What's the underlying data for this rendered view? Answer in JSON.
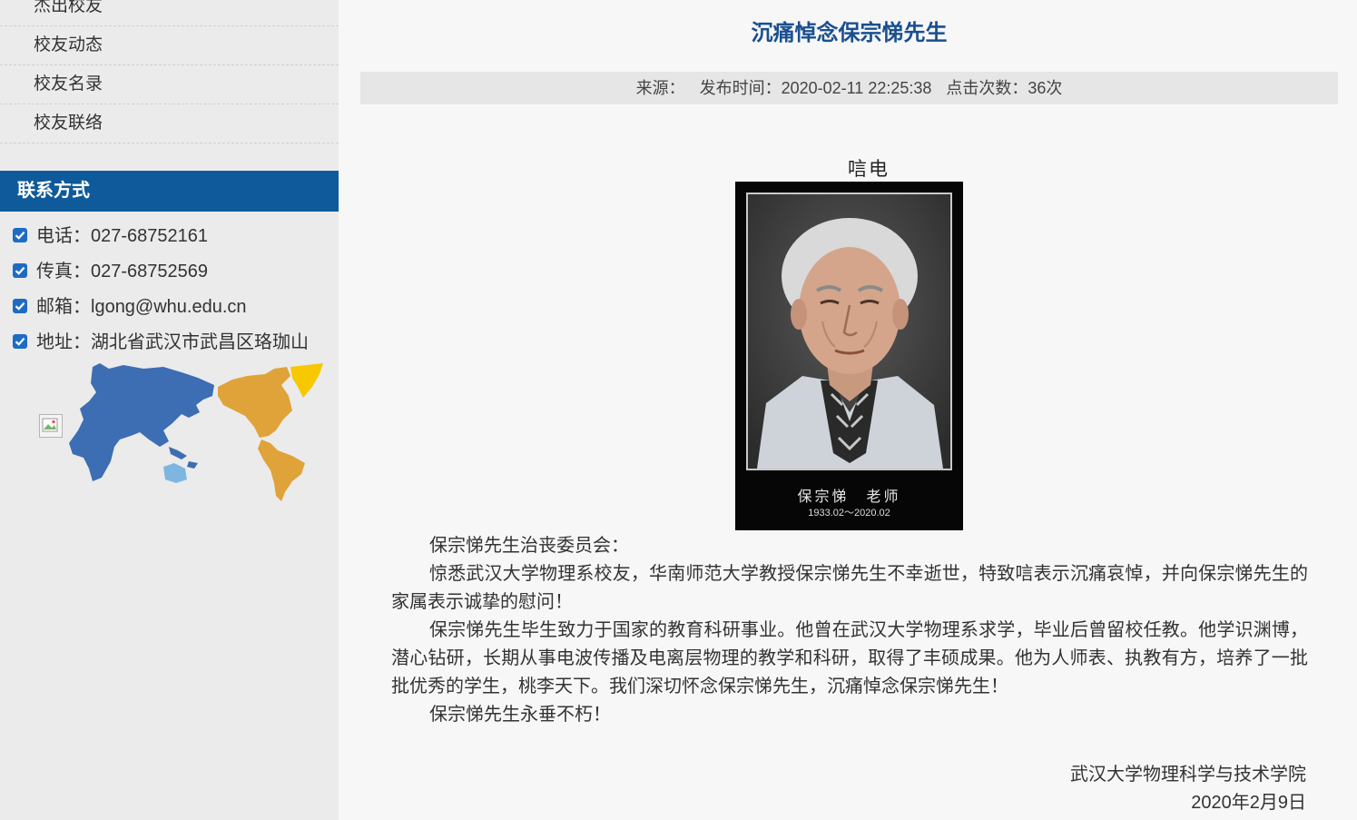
{
  "sidebar": {
    "nav": [
      "杰出校友",
      "校友动态",
      "校友名录",
      "校友联络"
    ],
    "contact_title": "联系方式",
    "contacts": [
      "电话：027-68752161",
      "传真：027-68752569",
      "邮箱：lgong@whu.edu.cn",
      "地址：湖北省武汉市武昌区珞珈山"
    ]
  },
  "article": {
    "title": "沉痛悼念保宗悌先生",
    "source": "来源：",
    "publish_time": "发布时间：2020-02-11 22:25:38",
    "views": "点击次数：36次",
    "caption": "唁电",
    "photo_name": "保宗悌　老师",
    "photo_dates": "1933.02～2020.02",
    "paragraphs": [
      "保宗悌先生治丧委员会：",
      "惊悉武汉大学物理系校友，华南师范大学教授保宗悌先生不幸逝世，特致唁表示沉痛哀悼，并向保宗悌先生的家属表示诚挚的慰问！",
      "保宗悌先生毕生致力于国家的教育科研事业。他曾在武汉大学物理系求学，毕业后曾留校任教。他学识渊博，潜心钻研，长期从事电波传播及电离层物理的教学和科研，取得了丰硕成果。他为人师表、执教有方，培养了一批批优秀的学生，桃李天下。我们深切怀念保宗悌先生，沉痛悼念保宗悌先生！",
      "保宗悌先生永垂不朽！"
    ],
    "signature_org": "武汉大学物理科学与技术学院",
    "signature_date": "2020年2月9日"
  },
  "colors": {
    "accent": "#0e5a9a",
    "title": "#1a4f8f",
    "checkbox": "#1e6bc4",
    "map_asia": "#3d6db2",
    "map_americas": "#e0a33a",
    "map_greenland": "#f7c800",
    "map_australia": "#7fb6e0"
  }
}
